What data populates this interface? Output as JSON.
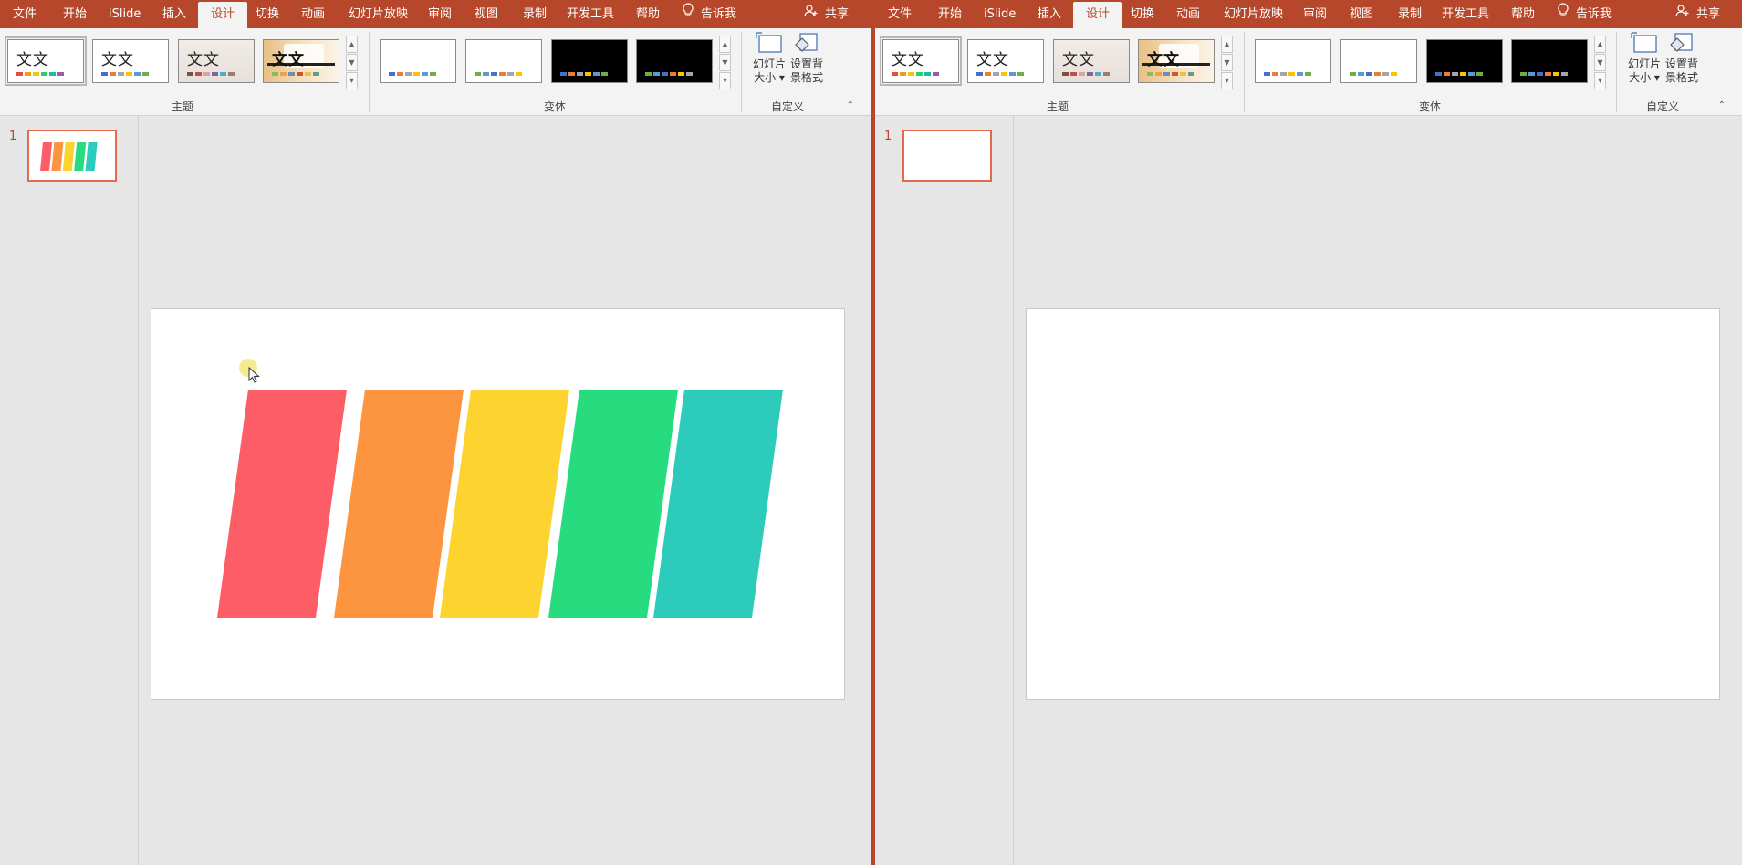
{
  "tabs": [
    "文件",
    "开始",
    "iSlide",
    "插入",
    "设计",
    "切换",
    "动画",
    "幻灯片放映",
    "审阅",
    "视图",
    "录制",
    "开发工具",
    "帮助"
  ],
  "active_tab": "设计",
  "tell_me": "告诉我",
  "share": "共享",
  "groups": {
    "themes": "主题",
    "variants": "变体",
    "customize": "自定义"
  },
  "theme_sample_text": "文文",
  "theme_brush_text": "文文",
  "slide_size_line1": "幻灯片",
  "slide_size_line2": "大小",
  "format_bg_line1": "设置背",
  "format_bg_line2": "景格式",
  "slide_number": "1",
  "colors": {
    "accent": "#b7472a",
    "ribbon_bg": "#f3f3f3",
    "workspace_bg": "#e6e6e6",
    "bar_red": "#fd5d66",
    "bar_orange": "#fd943f",
    "bar_yellow": "#fdd32f",
    "bar_green": "#26dc7e",
    "bar_teal": "#2ccbbb"
  },
  "theme_swatches": [
    [
      "#e84c3d",
      "#f39c12",
      "#f1c40f",
      "#2ecc71",
      "#1abc9c",
      "#9b59b6"
    ],
    [
      "#4472c4",
      "#ed7d31",
      "#a5a5a5",
      "#ffc000",
      "#5b9bd5",
      "#70ad47"
    ],
    [
      "#7f4f3f",
      "#c0504d",
      "#d4a5a5",
      "#8064a2",
      "#4bacc6",
      "#9e7a6b"
    ],
    [
      "#8bbc56",
      "#e8a34b",
      "#6d8fb7",
      "#c55a2d",
      "#f0c04e",
      "#5f9e8f"
    ]
  ],
  "variant_swatches": [
    [
      "#4472c4",
      "#ed7d31",
      "#a5a5a5",
      "#ffc000",
      "#5b9bd5",
      "#70ad47"
    ],
    [
      "#70ad47",
      "#5b9bd5",
      "#4472c4",
      "#ed7d31",
      "#a5a5a5",
      "#ffc000"
    ],
    [
      "#4472c4",
      "#ed7d31",
      "#a5a5a5",
      "#ffc000",
      "#5b9bd5",
      "#70ad47"
    ],
    [
      "#70ad47",
      "#5b9bd5",
      "#4472c4",
      "#ed7d31",
      "#ffc000",
      "#a5a5a5"
    ]
  ],
  "slide_bars": [
    "#fd5d66",
    "#fd943f",
    "#fdd32f",
    "#26dc7e",
    "#2ccbbb"
  ],
  "icons": [
    "lightbulb-icon",
    "person-share-icon",
    "slide-size-icon",
    "format-background-icon",
    "collapse-ribbon-icon",
    "mouse-cursor-icon"
  ]
}
